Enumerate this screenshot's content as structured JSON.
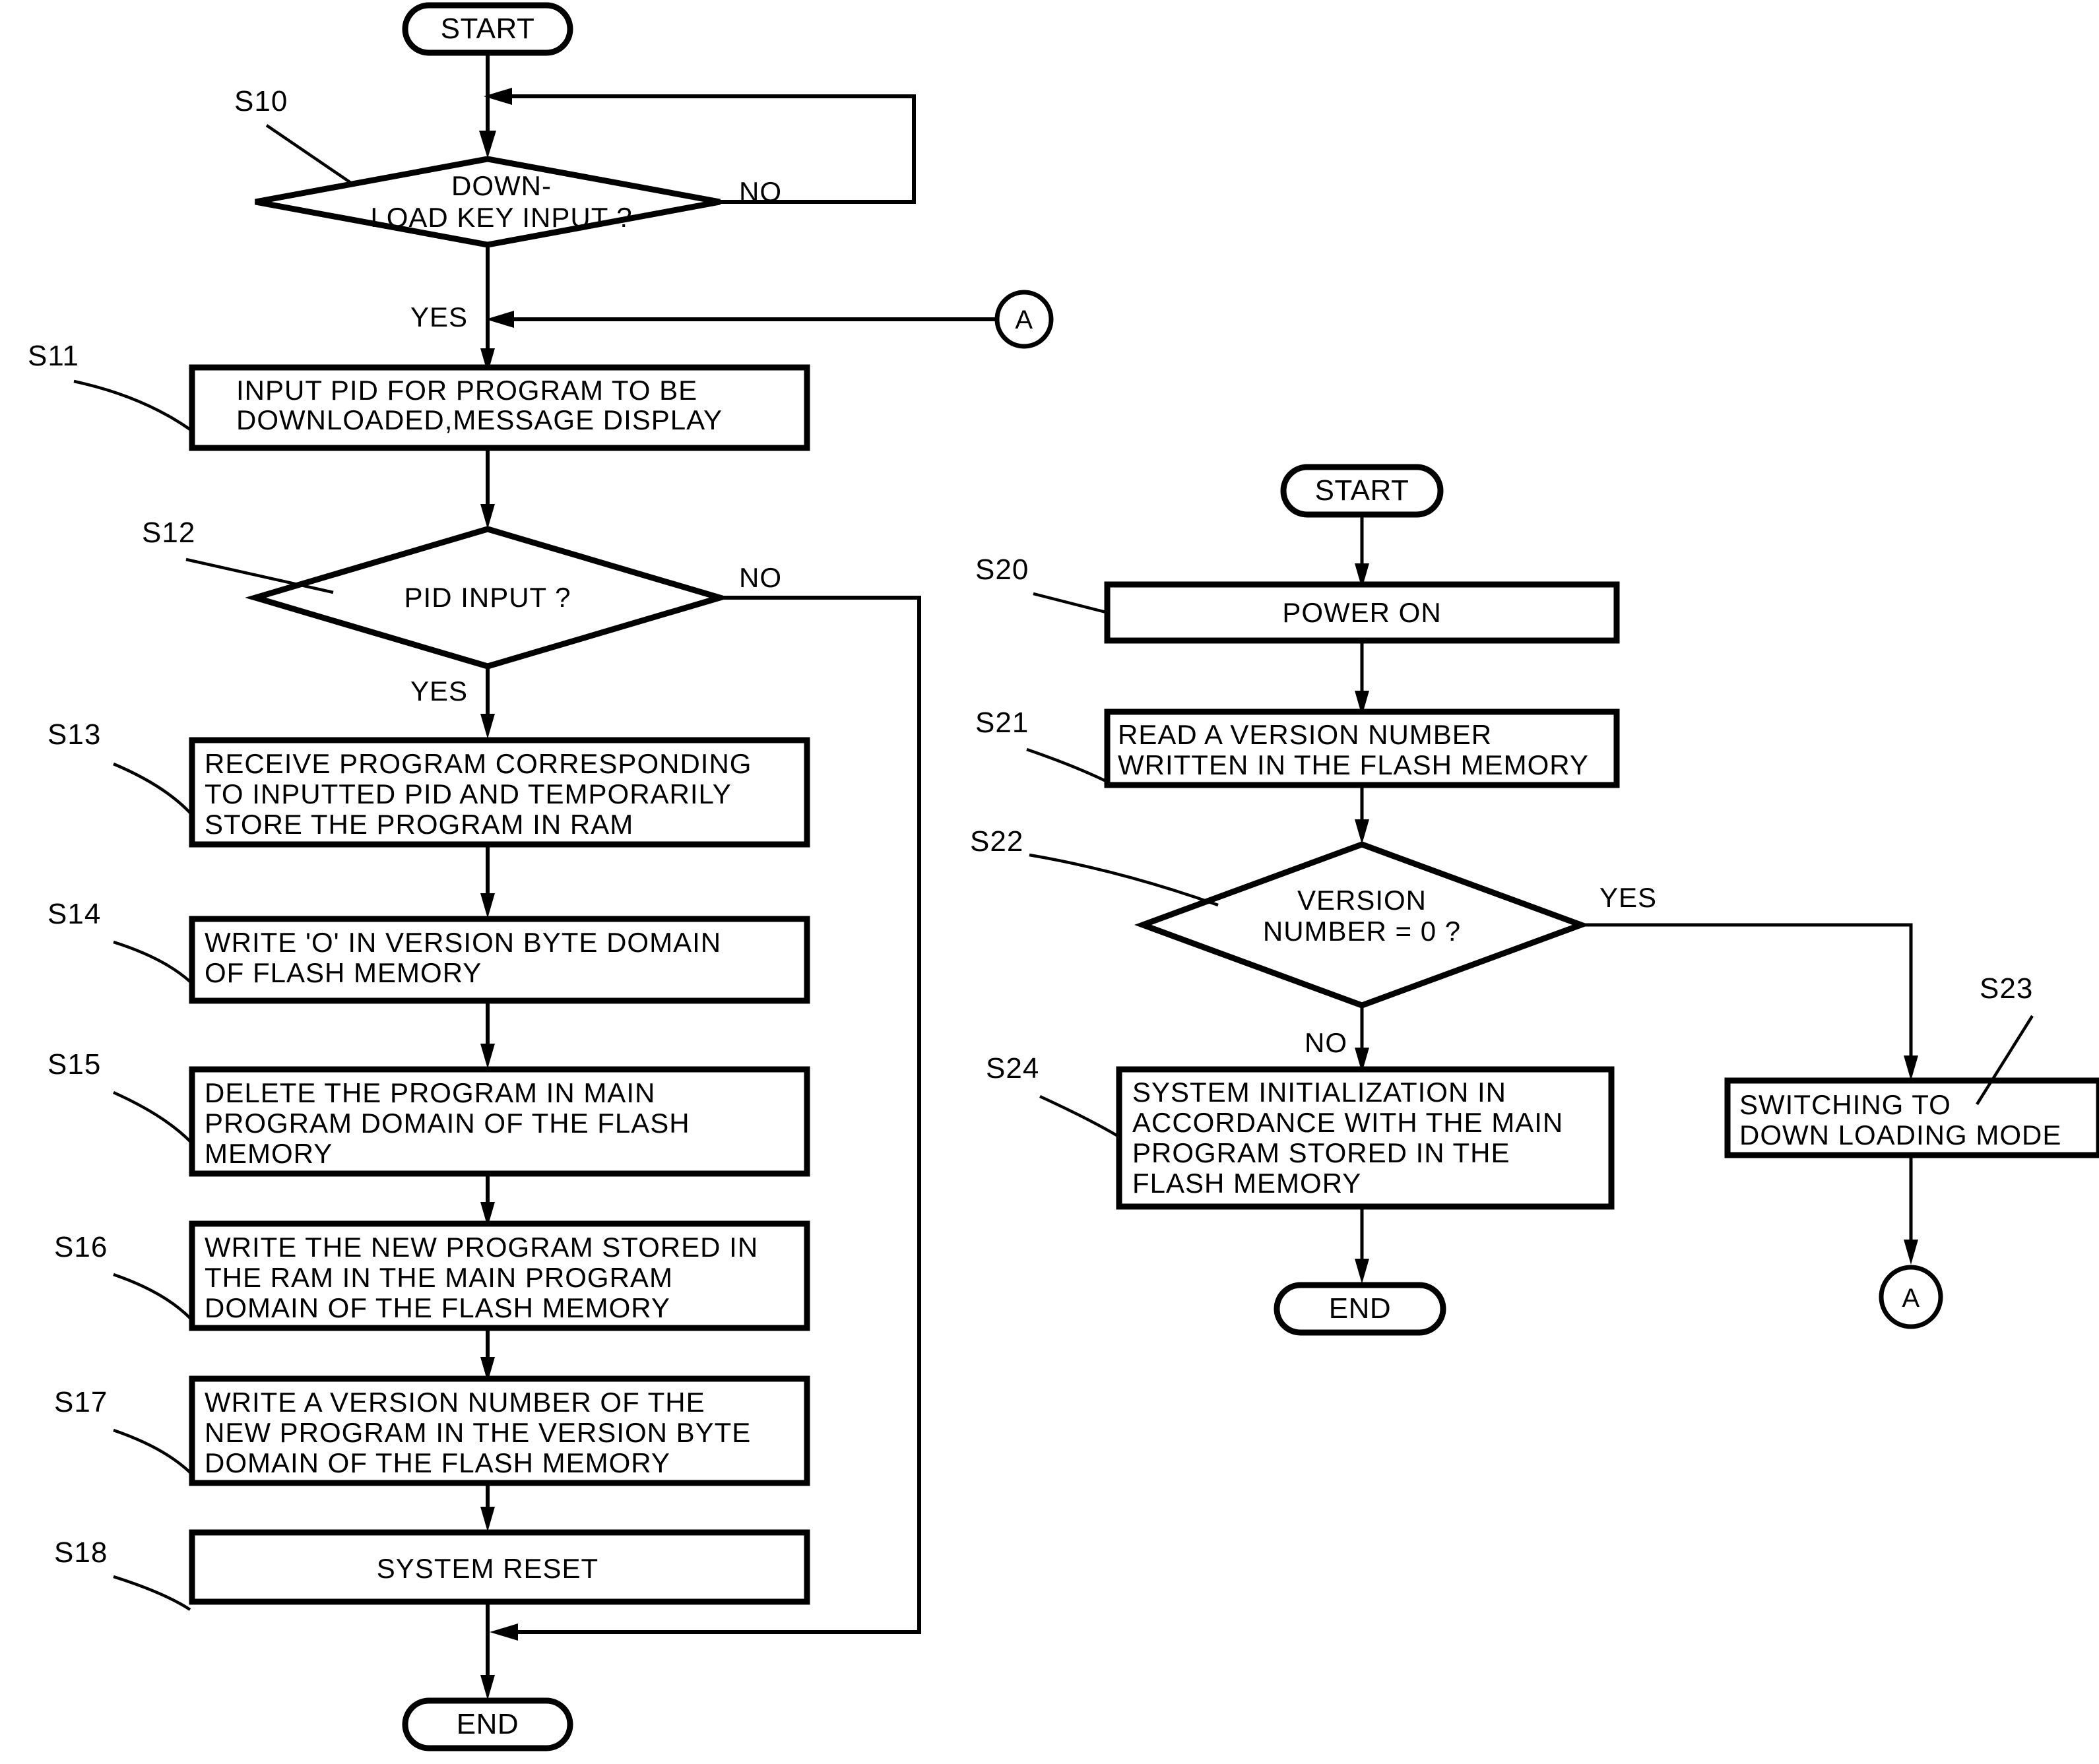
{
  "diagram": {
    "title": "Program download and power-on version check flowchart",
    "stroke_color": "#000000",
    "background_color": "#ffffff"
  },
  "left_flow": {
    "start": {
      "label": "START"
    },
    "end": {
      "label": "END"
    },
    "connector_in": {
      "label": "A"
    },
    "steps": [
      {
        "tag": "S10",
        "type": "decision",
        "lines": [
          "DOWN-",
          "LOAD KEY INPUT ?"
        ],
        "yes": "YES",
        "no": "NO"
      },
      {
        "tag": "S11",
        "type": "process",
        "lines": [
          "INPUT PID FOR PROGRAM TO BE",
          "DOWNLOADED,MESSAGE DISPLAY"
        ]
      },
      {
        "tag": "S12",
        "type": "decision",
        "lines": [
          "PID INPUT ?"
        ],
        "yes": "YES",
        "no": "NO"
      },
      {
        "tag": "S13",
        "type": "process",
        "lines": [
          "RECEIVE PROGRAM CORRESPONDING",
          "TO INPUTTED PID AND TEMPORARILY",
          "STORE THE PROGRAM IN RAM"
        ]
      },
      {
        "tag": "S14",
        "type": "process",
        "lines": [
          "WRITE 'O' IN VERSION BYTE DOMAIN",
          "OF FLASH MEMORY"
        ]
      },
      {
        "tag": "S15",
        "type": "process",
        "lines": [
          "DELETE THE PROGRAM IN MAIN",
          "PROGRAM DOMAIN OF THE FLASH",
          "MEMORY"
        ]
      },
      {
        "tag": "S16",
        "type": "process",
        "lines": [
          "WRITE THE NEW PROGRAM STORED IN",
          "THE  RAM IN THE MAIN PROGRAM",
          "DOMAIN OF THE FLASH MEMORY"
        ]
      },
      {
        "tag": "S17",
        "type": "process",
        "lines": [
          "WRITE A VERSION NUMBER OF THE",
          "NEW PROGRAM IN THE VERSION BYTE",
          "DOMAIN OF THE FLASH MEMORY"
        ]
      },
      {
        "tag": "S18",
        "type": "process",
        "lines": [
          "SYSTEM RESET"
        ]
      }
    ]
  },
  "right_flow": {
    "start": {
      "label": "START"
    },
    "end": {
      "label": "END"
    },
    "connector_out": {
      "label": "A"
    },
    "steps": [
      {
        "tag": "S20",
        "type": "process",
        "lines": [
          "POWER ON"
        ]
      },
      {
        "tag": "S21",
        "type": "process",
        "lines": [
          "READ A VERSION NUMBER",
          "WRITTEN IN THE FLASH MEMORY"
        ]
      },
      {
        "tag": "S22",
        "type": "decision",
        "lines": [
          "VERSION",
          "NUMBER = 0 ?"
        ],
        "yes": "YES",
        "no": "NO"
      },
      {
        "tag": "S23",
        "type": "process",
        "lines": [
          "SWITCHING TO",
          "DOWN LOADING MODE"
        ]
      },
      {
        "tag": "S24",
        "type": "process",
        "lines": [
          "SYSTEM INITIALIZATION IN",
          "ACCORDANCE WITH THE MAIN",
          "PROGRAM STORED IN THE",
          "FLASH MEMORY"
        ]
      }
    ]
  }
}
